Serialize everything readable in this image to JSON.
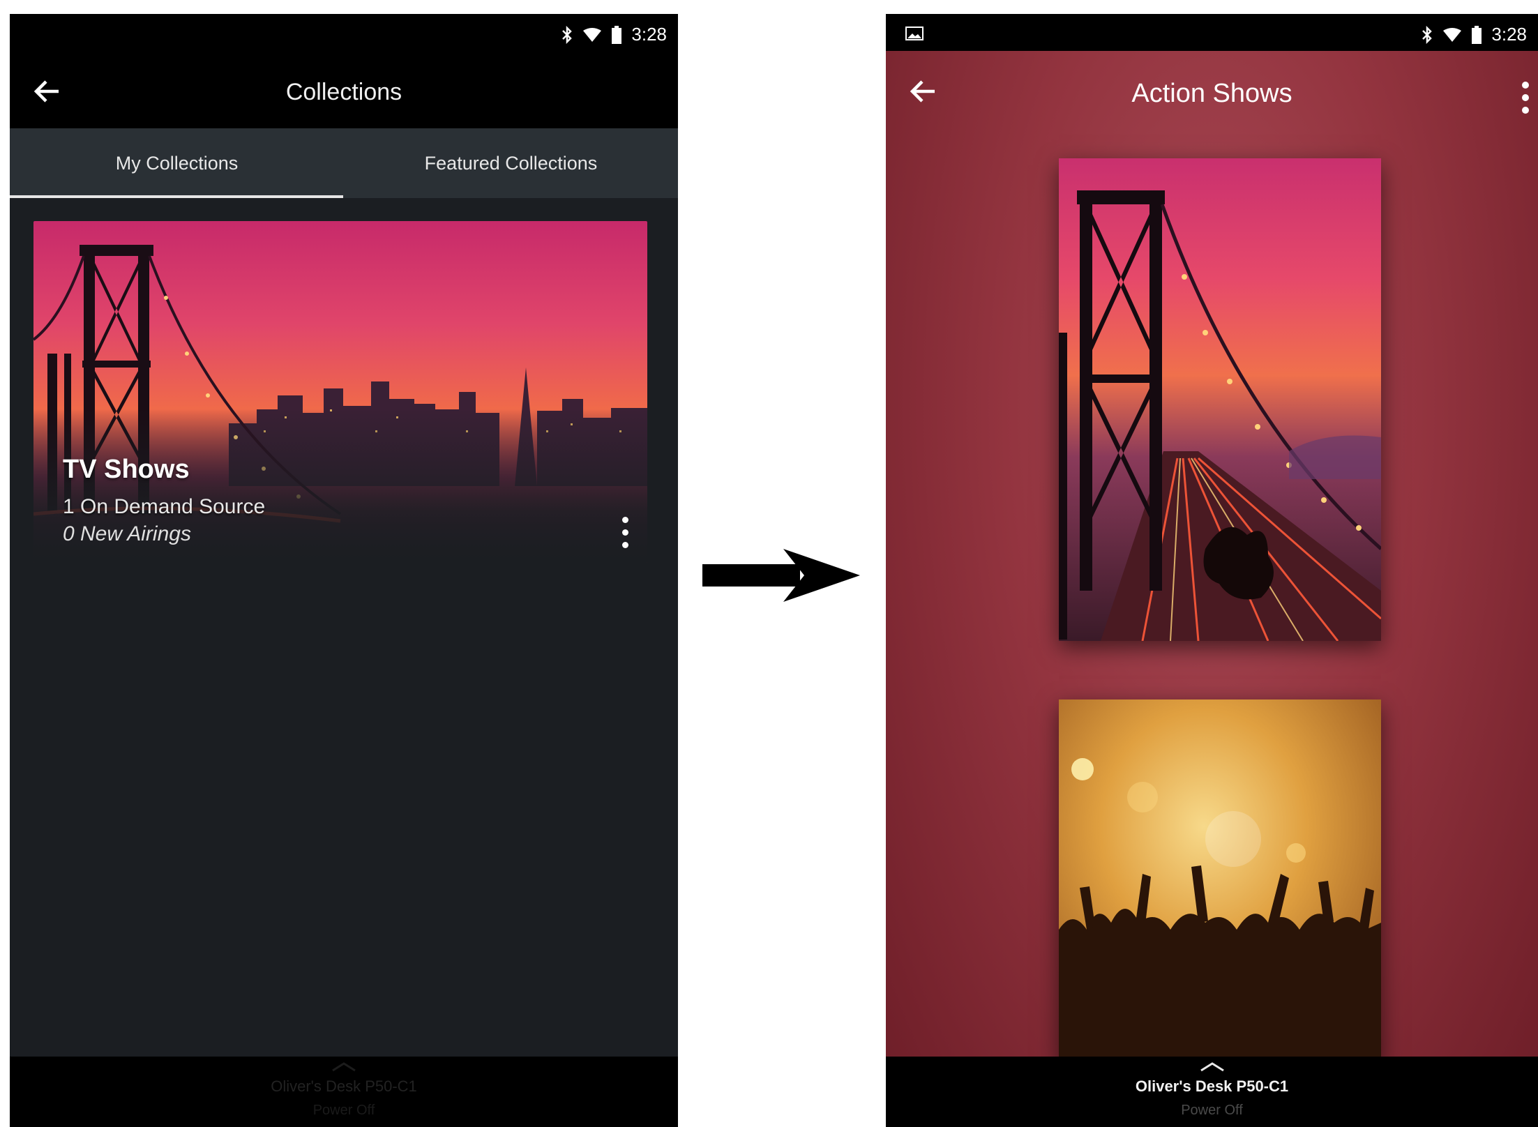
{
  "left_screen": {
    "status": {
      "time": "3:28",
      "icons": [
        "bluetooth-icon",
        "wifi-icon",
        "battery-icon"
      ]
    },
    "app_bar": {
      "title": "Collections",
      "back_icon": "back-arrow-icon"
    },
    "tabs": [
      {
        "label": "My Collections",
        "selected": true
      },
      {
        "label": "Featured Collections",
        "selected": false
      }
    ],
    "collection_card": {
      "title": "TV Shows",
      "sources": "1 On Demand Source",
      "airings": "0 New Airings",
      "menu_icon": "more-vert-icon"
    },
    "bottom_bar": {
      "device": "Oliver's Desk P50-C1",
      "status": "Power Off"
    }
  },
  "right_screen": {
    "status": {
      "time": "3:28",
      "icons": [
        "gallery-icon",
        "bluetooth-icon",
        "wifi-icon",
        "battery-icon"
      ]
    },
    "app_bar": {
      "title": "Action Shows",
      "back_icon": "back-arrow-icon",
      "menu_icon": "more-vert-icon"
    },
    "posters": [
      {
        "subject": "bridge-at-sunset"
      },
      {
        "subject": "concert-crowd"
      }
    ],
    "bottom_bar": {
      "device": "Oliver's Desk P50-C1",
      "status": "Power Off"
    }
  },
  "colors": {
    "left_background": "#1b1e22",
    "tab_background": "#2a3035",
    "right_background": "#93343f",
    "bars": "#000000"
  }
}
